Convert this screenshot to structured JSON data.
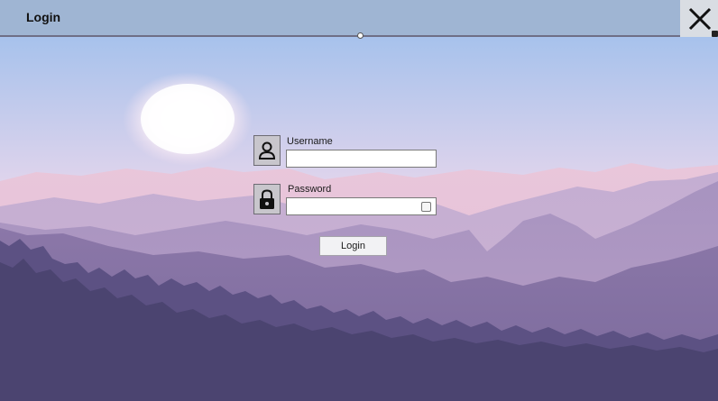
{
  "window": {
    "title": "Login"
  },
  "form": {
    "username_label": "Username",
    "username_value": "",
    "password_label": "Password",
    "password_value": "",
    "login_label": "Login"
  },
  "icons": {
    "close": "close-icon",
    "user": "user-icon",
    "lock": "lock-icon"
  },
  "colors": {
    "title_bar": "#9fb5d3",
    "sky_top": "#a7c2ec",
    "sky_bottom": "#f3dde8",
    "sun": "#fff8f8",
    "forest": "#4b4470"
  }
}
